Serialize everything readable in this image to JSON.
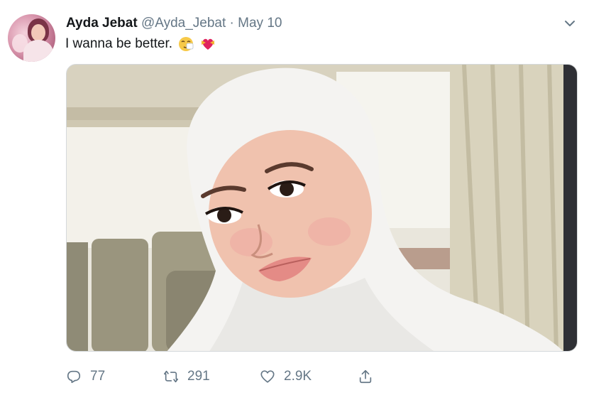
{
  "tweet": {
    "author_name": "Ayda Jebat",
    "author_handle": "@Ayda_Jebat",
    "separator": "·",
    "date": "May 10",
    "text": "I wanna be better.",
    "emojis": [
      "sneezing-face",
      "heart-with-ribbon"
    ]
  },
  "actions": {
    "replies": "77",
    "retweets": "291",
    "likes": "2.9K"
  },
  "icons": [
    "more-options-chevron-icon",
    "reply-icon",
    "retweet-icon",
    "like-icon",
    "share-icon"
  ],
  "colors": {
    "text": "#14171a",
    "muted": "#657786"
  }
}
